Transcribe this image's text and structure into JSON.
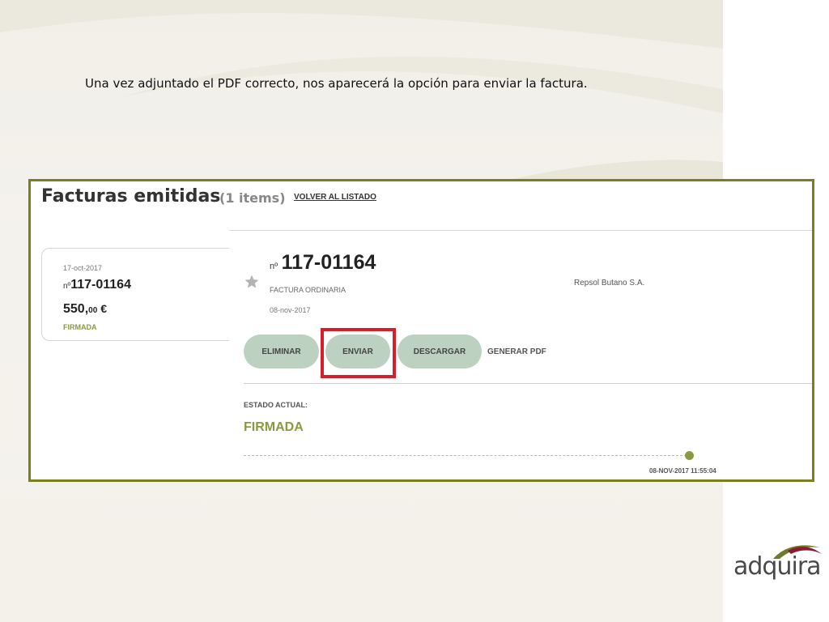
{
  "slide": {
    "caption": "Una vez adjuntado el PDF correcto, nos aparecerá la opción para enviar la factura.",
    "brand": "adquira"
  },
  "list": {
    "title": "Facturas emitidas",
    "count": "(1 items)",
    "back_link": "VOLVER AL LISTADO"
  },
  "card": {
    "date": "17-oct-2017",
    "number_prefix": "nº",
    "number": "117-01164",
    "amount_int": "550,",
    "amount_dec": "00",
    "currency": "€",
    "status": "FIRMADA"
  },
  "detail": {
    "number_prefix": "nº",
    "number": "117-01164",
    "type": "FACTURA ORDINARIA",
    "date": "08-nov-2017",
    "issuer": "Repsol Butano S.A.",
    "actions": {
      "delete": "ELIMINAR",
      "send": "ENVIAR",
      "download": "DESCARGAR",
      "generate_pdf": "GENERAR PDF"
    },
    "state_label": "ESTADO ACTUAL:",
    "state_value": "FIRMADA",
    "timestamp": "08-NOV-2017 11:55:04"
  },
  "colors": {
    "frame_border": "#7a7f1e",
    "accent_green": "#8a9a3e",
    "button_bg": "#bdd1c1",
    "highlight_red": "#d81e28",
    "logo_red": "#8b1e2e"
  },
  "icons": {
    "favorite": "star-icon",
    "brand_mark": "adquira-swoosh-icon"
  }
}
